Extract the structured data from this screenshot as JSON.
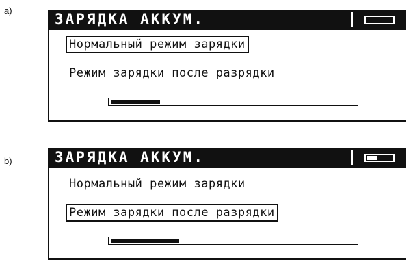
{
  "panels": [
    {
      "label": "a)",
      "title": "ЗАРЯДКА АККУМ.",
      "battery_level": 0.0,
      "options": [
        {
          "label": "Нормальный режим зарядки",
          "selected": true
        },
        {
          "label": "Режим зарядки после разрядки",
          "selected": false
        }
      ],
      "progress": 0.2
    },
    {
      "label": "b)",
      "title": "ЗАРЯДКА АККУМ.",
      "battery_level": 0.4,
      "options": [
        {
          "label": "Нормальный режим зарядки",
          "selected": false
        },
        {
          "label": "Режим зарядки после разрядки",
          "selected": true
        }
      ],
      "progress": 0.28
    }
  ],
  "colors": {
    "foreground": "#111111",
    "background": "#ffffff"
  },
  "icons": {
    "battery": "battery-icon"
  }
}
